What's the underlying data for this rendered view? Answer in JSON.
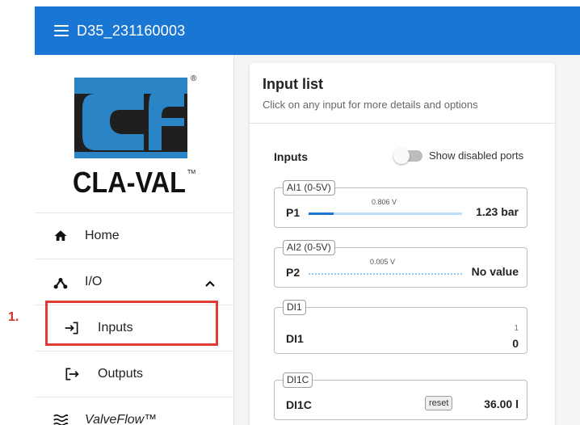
{
  "annotation": {
    "step": "1."
  },
  "header": {
    "title": "D35_231160003",
    "menu_icon": "hamburger-menu-icon",
    "bg_color": "#1976d2"
  },
  "logo": {
    "text": "CLA-VAL",
    "tm": "TM",
    "registered": "®"
  },
  "sidebar": {
    "items": [
      {
        "label": "Home",
        "icon": "home-icon"
      },
      {
        "label": "I/O",
        "icon": "io-tree-icon",
        "expanded": true
      },
      {
        "label": "Inputs",
        "icon": "login-arrow-icon",
        "selected": true
      },
      {
        "label": "Outputs",
        "icon": "logout-arrow-icon"
      },
      {
        "label": "ValveFlow™",
        "icon": "waves-icon"
      }
    ]
  },
  "card": {
    "title": "Input list",
    "subtitle": "Click on any input for more details and options",
    "inputs_heading": "Inputs",
    "toggle_label": "Show disabled ports",
    "toggle_on": false
  },
  "ports": [
    {
      "tag": "AI1 (0-5V)",
      "name": "P1",
      "voltage": "0.806 V",
      "value": "1.23 bar",
      "level": 0.161
    },
    {
      "tag": "AI2 (0-5V)",
      "name": "P2",
      "voltage": "0.005 V",
      "value": "No value"
    },
    {
      "tag": "DI1",
      "name": "DI1",
      "raw": "1",
      "value": "0"
    },
    {
      "tag": "DI1C",
      "name": "DI1C",
      "button": "reset",
      "value": "36.00 l"
    }
  ],
  "colors": {
    "accent": "#1976d2",
    "highlight": "#e53935",
    "logo_blue": "#2b84c6"
  }
}
